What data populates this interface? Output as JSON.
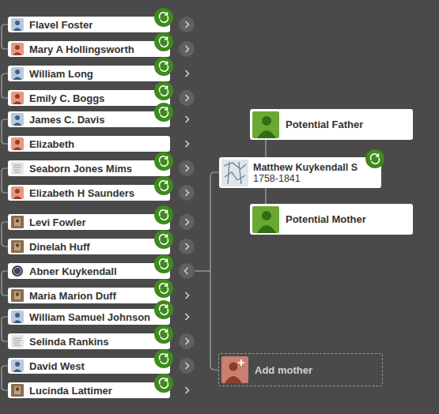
{
  "ancestors": [
    {
      "name": "Flavel Foster",
      "avatar": "male",
      "hint": true,
      "more": true,
      "expanded": false
    },
    {
      "name": "Mary A Hollingsworth",
      "avatar": "female",
      "hint": true,
      "more": true,
      "expanded": false
    },
    {
      "name": "William Long",
      "avatar": "male",
      "hint": true,
      "more": false,
      "expanded": false
    },
    {
      "name": "Emily C. Boggs",
      "avatar": "female",
      "hint": true,
      "more": true,
      "expanded": false
    },
    {
      "name": "James C. Davis",
      "avatar": "male",
      "hint": true,
      "more": false,
      "expanded": false
    },
    {
      "name": "Elizabeth",
      "avatar": "female",
      "hint": false,
      "more": false,
      "expanded": false
    },
    {
      "name": "Seaborn Jones Mims",
      "avatar": "document",
      "hint": true,
      "more": true,
      "expanded": false
    },
    {
      "name": "Elizabeth H Saunders",
      "avatar": "female",
      "hint": true,
      "more": true,
      "expanded": false
    },
    {
      "name": "Levi Fowler",
      "avatar": "photo",
      "hint": true,
      "more": true,
      "expanded": false
    },
    {
      "name": "Dinelah Huff",
      "avatar": "photo",
      "hint": true,
      "more": true,
      "expanded": false
    },
    {
      "name": "Abner Kuykendall",
      "avatar": "seal",
      "hint": true,
      "more": true,
      "expanded": true
    },
    {
      "name": "Maria Marion Duff",
      "avatar": "photo",
      "hint": true,
      "more": false,
      "expanded": false
    },
    {
      "name": "William Samuel Johnson",
      "avatar": "male",
      "hint": true,
      "more": false,
      "expanded": false
    },
    {
      "name": "Selinda Rankins",
      "avatar": "document",
      "hint": true,
      "more": true,
      "expanded": false
    },
    {
      "name": "David West",
      "avatar": "male",
      "hint": true,
      "more": true,
      "expanded": false
    },
    {
      "name": "Lucinda Lattimer",
      "avatar": "photo",
      "hint": true,
      "more": false,
      "expanded": false
    }
  ],
  "focus": {
    "name": "Matthew Kuykendall S",
    "years": "1758-1841",
    "hint": true
  },
  "parents": [
    {
      "label": "Potential Father"
    },
    {
      "label": "Potential Mother"
    }
  ],
  "add_parent": {
    "label": "Add mother"
  }
}
